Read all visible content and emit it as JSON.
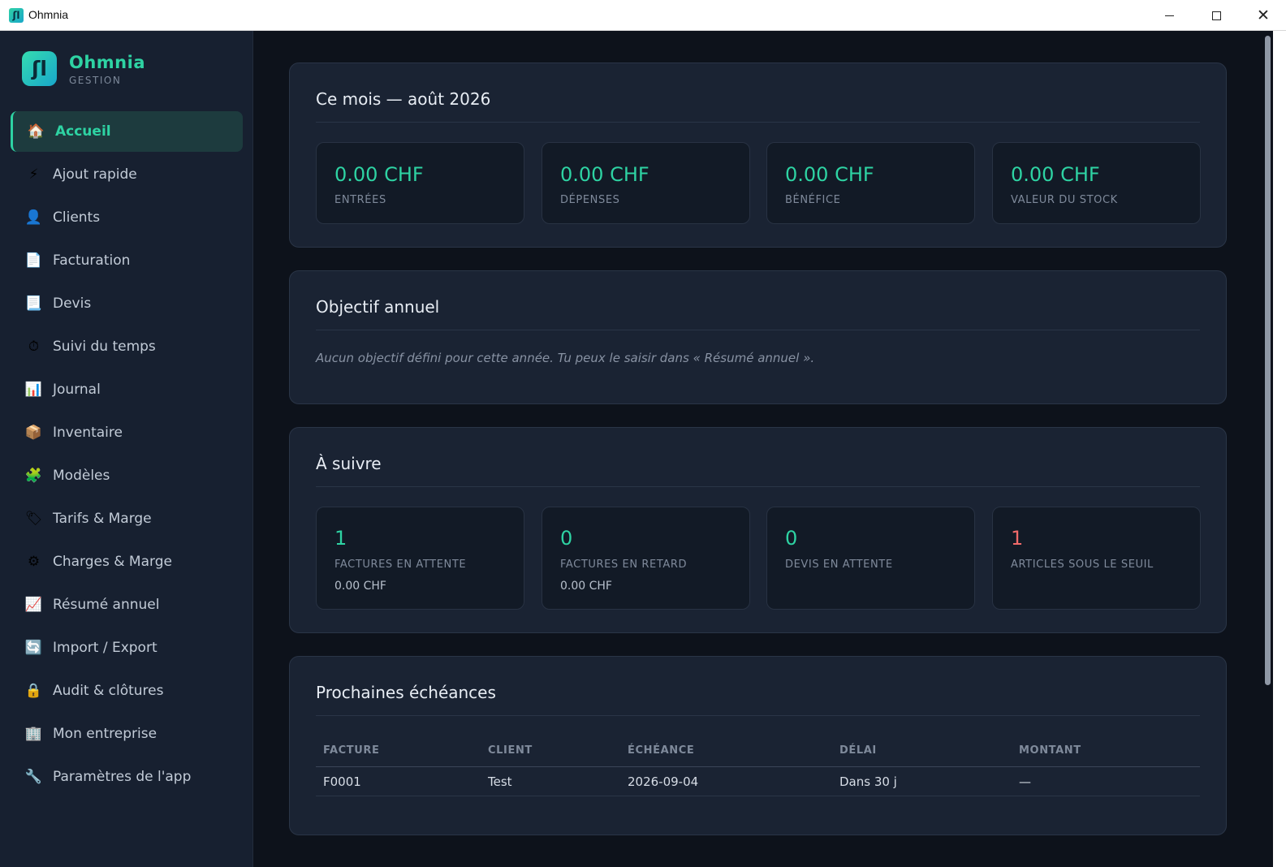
{
  "window": {
    "title": "Ohmnia",
    "minimize": "minimize-icon",
    "maximize": "maximize-icon",
    "close_glyph": "✕"
  },
  "brand": {
    "logo_glyph": "ʃl",
    "name": "Ohmnia",
    "subtitle": "GESTION"
  },
  "sidebar": {
    "items": [
      {
        "label": "Accueil",
        "icon": "🏠",
        "active": true
      },
      {
        "label": "Ajout rapide",
        "icon": "⚡"
      },
      {
        "label": "Clients",
        "icon": "👤"
      },
      {
        "label": "Facturation",
        "icon": "📄"
      },
      {
        "label": "Devis",
        "icon": "📃"
      },
      {
        "label": "Suivi du temps",
        "icon": "⏱"
      },
      {
        "label": "Journal",
        "icon": "📊"
      },
      {
        "label": "Inventaire",
        "icon": "📦"
      },
      {
        "label": "Modèles",
        "icon": "🧩"
      },
      {
        "label": "Tarifs & Marge",
        "icon": "🏷"
      },
      {
        "label": "Charges & Marge",
        "icon": "⚙"
      },
      {
        "label": "Résumé annuel",
        "icon": "📈"
      },
      {
        "label": "Import / Export",
        "icon": "🔄"
      },
      {
        "label": "Audit & clôtures",
        "icon": "🔒"
      },
      {
        "label": "Mon entreprise",
        "icon": "🏢"
      },
      {
        "label": "Paramètres de l'app",
        "icon": "🔧"
      }
    ]
  },
  "month": {
    "title": "Ce mois — août 2026",
    "stats": [
      {
        "value": "0.00 CHF",
        "label": "ENTRÉES"
      },
      {
        "value": "0.00 CHF",
        "label": "DÉPENSES"
      },
      {
        "value": "0.00 CHF",
        "label": "BÉNÉFICE"
      },
      {
        "value": "0.00 CHF",
        "label": "VALEUR DU STOCK"
      }
    ]
  },
  "objective": {
    "title": "Objectif annuel",
    "empty_text": "Aucun objectif défini pour cette année. Tu peux le saisir dans « Résumé annuel »."
  },
  "todo": {
    "title": "À suivre",
    "stats": [
      {
        "value": "1",
        "label": "FACTURES EN ATTENTE",
        "sub": "0.00 CHF"
      },
      {
        "value": "0",
        "label": "FACTURES EN RETARD",
        "sub": "0.00 CHF"
      },
      {
        "value": "0",
        "label": "DEVIS EN ATTENTE"
      },
      {
        "value": "1",
        "label": "ARTICLES SOUS LE SEUIL",
        "alert": true
      }
    ]
  },
  "due": {
    "title": "Prochaines échéances",
    "columns": [
      "FACTURE",
      "CLIENT",
      "ÉCHÉANCE",
      "DÉLAI",
      "MONTANT"
    ],
    "rows": [
      [
        "F0001",
        "Test",
        "2026-09-04",
        "Dans 30 j",
        "—"
      ]
    ]
  },
  "colors": {
    "accent": "#2ed3a3",
    "alert": "#f06a6a",
    "background": "#0d121b",
    "card": "#1a2333",
    "sidebar": "#172030"
  }
}
